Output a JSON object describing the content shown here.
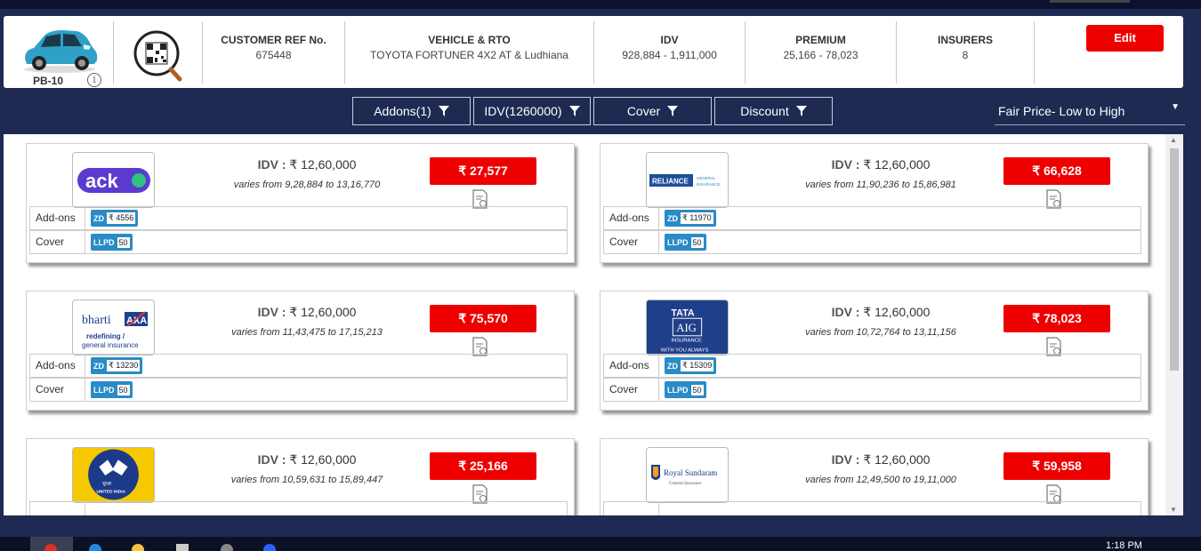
{
  "summary": {
    "car_label": "PB-10",
    "info_symbol": "i",
    "customer_ref": {
      "label": "CUSTOMER REF No.",
      "value": "675448"
    },
    "vehicle": {
      "label": "VEHICLE & RTO",
      "value": "TOYOTA FORTUNER 4X2 AT & Ludhiana"
    },
    "idv": {
      "label": "IDV",
      "value": "928,884 - 1,911,000"
    },
    "premium": {
      "label": "PREMIUM",
      "value": "25,166 - 78,023"
    },
    "insurers": {
      "label": "INSURERS",
      "value": "8"
    },
    "edit_label": "Edit"
  },
  "filters": [
    {
      "label": "Addons(1)",
      "icon": "filter-icon"
    },
    {
      "label": "IDV(1260000)",
      "icon": "filter-icon"
    },
    {
      "label": "Cover",
      "icon": "filter-icon"
    },
    {
      "label": "Discount",
      "icon": "filter-icon"
    }
  ],
  "sort": {
    "selected": "Fair Price- Low to High",
    "arrow": "▼"
  },
  "labels": {
    "idv_prefix": "IDV :",
    "addons": "Add-ons",
    "cover": "Cover"
  },
  "quotes": [
    {
      "insurer": "acko",
      "logo_text": "acko",
      "idv": "₹ 12,60,000",
      "varies": "varies from 9,28,884 to 13,16,770",
      "price": "₹ 27,577",
      "addon_code": "ZD",
      "addon_value": "₹ 4556",
      "cover_code": "LLPD",
      "cover_value": "50"
    },
    {
      "insurer": "reliance",
      "logo_text": "RELIANCE",
      "logo_sub": "GENERAL INSURANCE",
      "idv": "₹ 12,60,000",
      "varies": "varies from 11,90,236 to 15,86,981",
      "price": "₹ 66,628",
      "addon_code": "ZD",
      "addon_value": "₹ 11970",
      "cover_code": "LLPD",
      "cover_value": "50"
    },
    {
      "insurer": "bharti-axa",
      "logo_text": "bharti",
      "logo_mark": "AXA",
      "logo_sub1": "redefining /",
      "logo_sub2": "general insurance",
      "idv": "₹ 12,60,000",
      "varies": "varies from 11,43,475 to 17,15,213",
      "price": "₹ 75,570",
      "addon_code": "ZD",
      "addon_value": "₹ 13230",
      "cover_code": "LLPD",
      "cover_value": "50"
    },
    {
      "insurer": "tata-aig",
      "logo_text": "TATA",
      "logo_mark": "AIG",
      "logo_sub1": "INSURANCE",
      "logo_sub2": "WITH YOU ALWAYS",
      "idv": "₹ 12,60,000",
      "varies": "varies from 10,72,764 to 13,11,156",
      "price": "₹ 78,023",
      "addon_code": "ZD",
      "addon_value": "₹ 15309",
      "cover_code": "LLPD",
      "cover_value": "50"
    },
    {
      "insurer": "united-india",
      "logo_text": "UNITED INDIA",
      "idv": "₹ 12,60,000",
      "varies": "varies from 10,59,631 to 15,89,447",
      "price": "₹ 25,166"
    },
    {
      "insurer": "royal-sundaram",
      "logo_text": "Royal Sundaram",
      "logo_sub": "General Insurance",
      "idv": "₹ 12,60,000",
      "varies": "varies from 12,49,500 to 19,11,000",
      "price": "₹ 59,958"
    }
  ],
  "taskbar": {
    "clock": "1:18 PM"
  },
  "colors": {
    "brand_red": "#ef0000",
    "navy": "#1e2a52",
    "chip_blue": "#2a8bc6"
  }
}
